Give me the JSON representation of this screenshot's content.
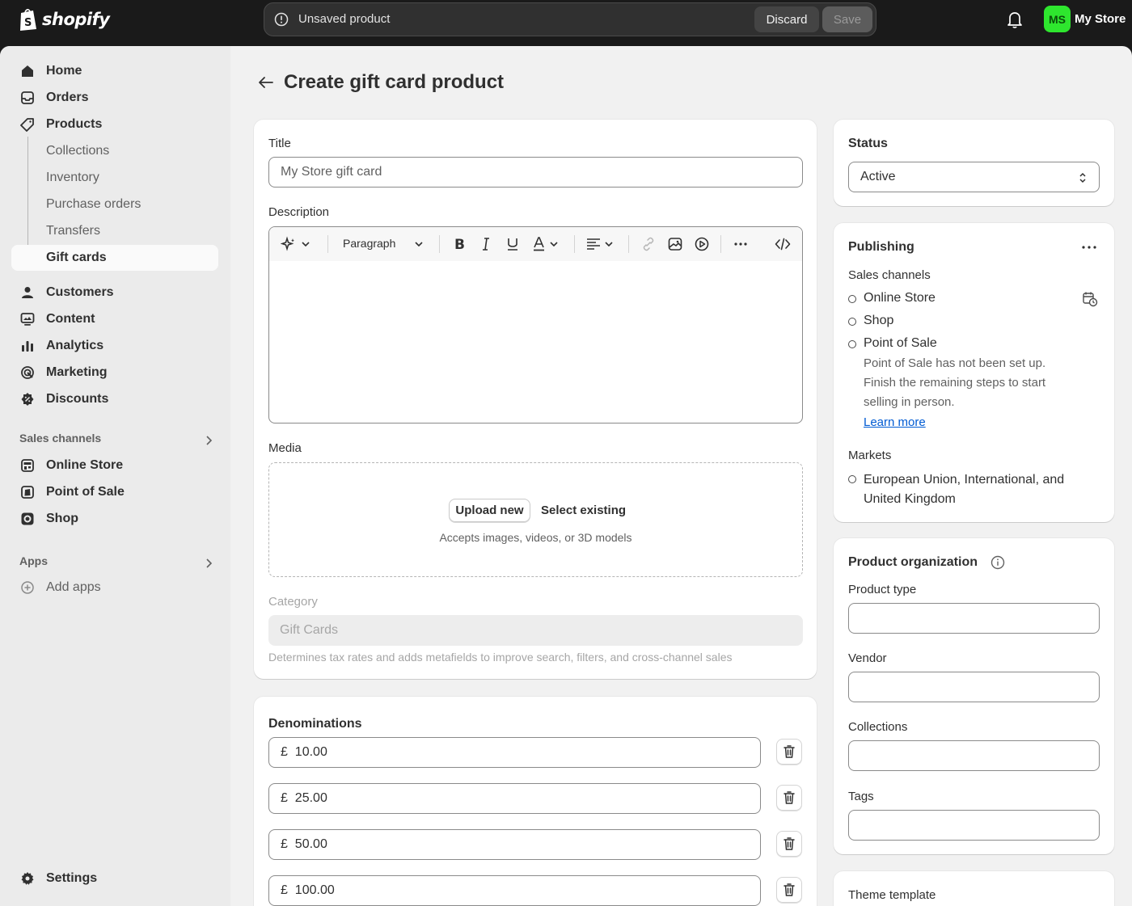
{
  "topbar": {
    "brand": "shopify",
    "unsaved_message": "Unsaved product",
    "discard_label": "Discard",
    "save_label": "Save",
    "avatar_initials": "MS",
    "store_name": "My Store"
  },
  "sidebar": {
    "items": [
      {
        "label": "Home",
        "icon": "home-icon"
      },
      {
        "label": "Orders",
        "icon": "inbox-icon"
      },
      {
        "label": "Products",
        "icon": "tag-icon"
      }
    ],
    "product_sub": [
      "Collections",
      "Inventory",
      "Purchase orders",
      "Transfers",
      "Gift cards"
    ],
    "items2": [
      {
        "label": "Customers",
        "icon": "person-icon"
      },
      {
        "label": "Content",
        "icon": "monitor-icon"
      },
      {
        "label": "Analytics",
        "icon": "bar-chart-icon"
      },
      {
        "label": "Marketing",
        "icon": "target-icon"
      },
      {
        "label": "Discounts",
        "icon": "discount-badge-icon"
      }
    ],
    "sales_channels_heading": "Sales channels",
    "channels": [
      "Online Store",
      "Point of Sale",
      "Shop"
    ],
    "apps_heading": "Apps",
    "add_apps": "Add apps",
    "settings": "Settings"
  },
  "page": {
    "title": "Create gift card product"
  },
  "main_card": {
    "title_label": "Title",
    "title_value": "My Store gift card",
    "description_label": "Description",
    "paragraph_select": "Paragraph",
    "media_label": "Media",
    "upload_new": "Upload new",
    "select_existing": "Select existing",
    "accepts": "Accepts images, videos, or 3D models",
    "category_label": "Category",
    "category_value": "Gift Cards",
    "category_help": "Determines tax rates and adds metafields to improve search, filters, and cross-channel sales"
  },
  "denominations": {
    "title": "Denominations",
    "currency": "£",
    "values": [
      "10.00",
      "25.00",
      "50.00",
      "100.00"
    ]
  },
  "status": {
    "title": "Status",
    "value": "Active"
  },
  "publishing": {
    "title": "Publishing",
    "sales_channels_label": "Sales channels",
    "channels": [
      "Online Store",
      "Shop",
      "Point of Sale"
    ],
    "pos_note": "Point of Sale has not been set up. Finish the remaining steps to start selling in person.",
    "learn_more": "Learn more",
    "markets_label": "Markets",
    "markets_value": "European Union, International, and United Kingdom"
  },
  "organization": {
    "title": "Product organization",
    "product_type_label": "Product type",
    "vendor_label": "Vendor",
    "collections_label": "Collections",
    "tags_label": "Tags"
  },
  "theme": {
    "title": "Theme template"
  },
  "colors": {
    "topbar": "#1a1a1a",
    "avatar": "#2ee62e",
    "link": "#005bd3",
    "background": "#f1f1f1"
  }
}
